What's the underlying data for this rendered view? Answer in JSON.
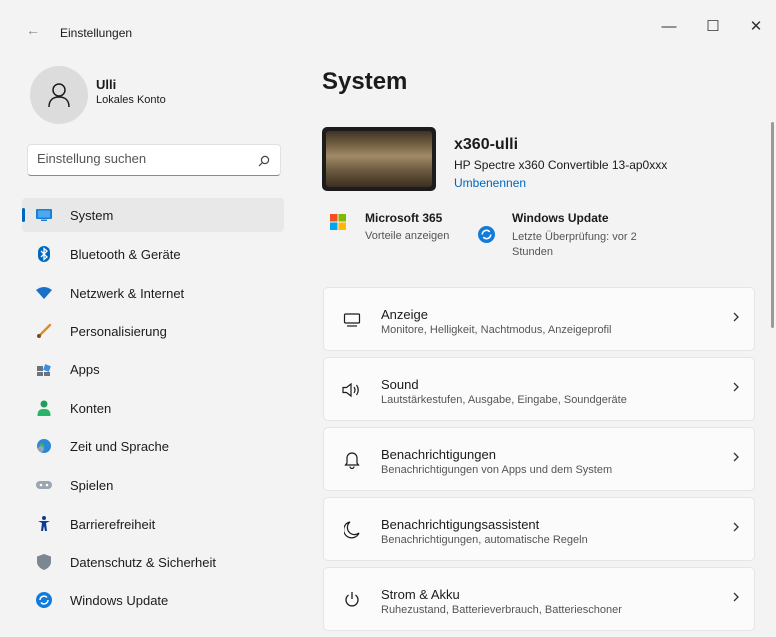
{
  "window": {
    "title": "Einstellungen",
    "back_glyph": "←",
    "minimize_glyph": "—",
    "maximize_glyph": "☐",
    "close_glyph": "✕"
  },
  "user": {
    "name": "Ulli",
    "account_type": "Lokales Konto"
  },
  "search": {
    "placeholder": "Einstellung suchen",
    "value": ""
  },
  "sidebar": {
    "items": [
      {
        "label": "System",
        "icon": "monitor-icon",
        "active": true
      },
      {
        "label": "Bluetooth & Geräte",
        "icon": "bluetooth-icon"
      },
      {
        "label": "Netzwerk & Internet",
        "icon": "wifi-icon"
      },
      {
        "label": "Personalisierung",
        "icon": "brush-icon"
      },
      {
        "label": "Apps",
        "icon": "apps-icon"
      },
      {
        "label": "Konten",
        "icon": "person-icon"
      },
      {
        "label": "Zeit und Sprache",
        "icon": "globe-clock-icon"
      },
      {
        "label": "Spielen",
        "icon": "gamepad-icon"
      },
      {
        "label": "Barrierefreiheit",
        "icon": "accessibility-icon"
      },
      {
        "label": "Datenschutz & Sicherheit",
        "icon": "shield-icon"
      },
      {
        "label": "Windows Update",
        "icon": "update-icon"
      }
    ]
  },
  "main": {
    "title": "System",
    "device": {
      "name": "x360-ulli",
      "model": "HP Spectre x360 Convertible 13-ap0xxx",
      "rename_link": "Umbenennen"
    },
    "tiles": [
      {
        "title": "Microsoft 365",
        "subtitle": "Vorteile anzeigen",
        "icon": "microsoft-logo-icon"
      },
      {
        "title": "Windows Update",
        "subtitle": "Letzte Überprüfung: vor 2 Stunden",
        "icon": "update-icon"
      }
    ],
    "cards": [
      {
        "title": "Anzeige",
        "subtitle": "Monitore, Helligkeit, Nachtmodus, Anzeigeprofil",
        "icon": "display-icon"
      },
      {
        "title": "Sound",
        "subtitle": "Lautstärkestufen, Ausgabe, Eingabe, Soundgeräte",
        "icon": "speaker-icon"
      },
      {
        "title": "Benachrichtigungen",
        "subtitle": "Benachrichtigungen von Apps und dem System",
        "icon": "bell-icon"
      },
      {
        "title": "Benachrichtigungsassistent",
        "subtitle": "Benachrichtigungen, automatische Regeln",
        "icon": "moon-icon"
      },
      {
        "title": "Strom & Akku",
        "subtitle": "Ruhezustand, Batterieverbrauch, Batterieschoner",
        "icon": "power-icon"
      }
    ]
  },
  "colors": {
    "accent": "#0067c0",
    "background": "#f3f3f3",
    "card": "#fbfbfb"
  }
}
